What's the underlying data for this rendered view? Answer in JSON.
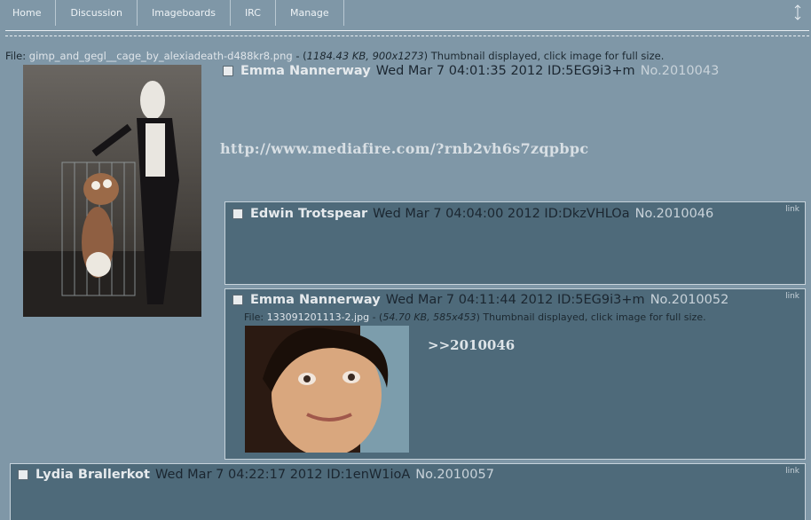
{
  "nav": {
    "items": [
      "Home",
      "Discussion",
      "Imageboards",
      "IRC",
      "Manage"
    ]
  },
  "op": {
    "file_label": "File: ",
    "file_name": "gimp_and_gegl__cage_by_alexiadeath-d488kr8.png",
    "file_sep": " - (",
    "file_meta": "1184.43 KB, 900x1273",
    "file_tail": ") Thumbnail displayed, click image for full size.",
    "name": "Emma Nannerway",
    "date": "Wed Mar 7 04:01:35 2012",
    "id": "ID:5EG9i3+m",
    "no": "No.2010043",
    "body_link": "http://www.mediafire.com/?rnb2vh6s7zqpbpc"
  },
  "replies": [
    {
      "name": "Edwin Trotspear",
      "date": "Wed Mar 7 04:04:00 2012",
      "id": "ID:DkzVHLOa",
      "no": "No.2010046",
      "link": "link"
    },
    {
      "name": "Emma Nannerway",
      "date": "Wed Mar 7 04:11:44 2012",
      "id": "ID:5EG9i3+m",
      "no": "No.2010052",
      "link": "link",
      "file_label": "File: ",
      "file_name": "133091201113-2.jpg",
      "file_sep": " - (",
      "file_meta": "54.70 KB, 585x453",
      "file_tail": ") Thumbnail displayed, click image for full size.",
      "quote": ">>2010046"
    },
    {
      "name": "Lydia Brallerkot",
      "date": "Wed Mar 7 04:22:17 2012",
      "id": "ID:1enW1ioA",
      "no": "No.2010057",
      "link": "link"
    }
  ],
  "icons": {
    "scroll": "vertical-resize-icon",
    "checkbox": "checkbox-icon"
  },
  "colors": {
    "background": "#7f97a7",
    "reply_bg": "#4e6a7a",
    "name": "#e6eaed"
  }
}
